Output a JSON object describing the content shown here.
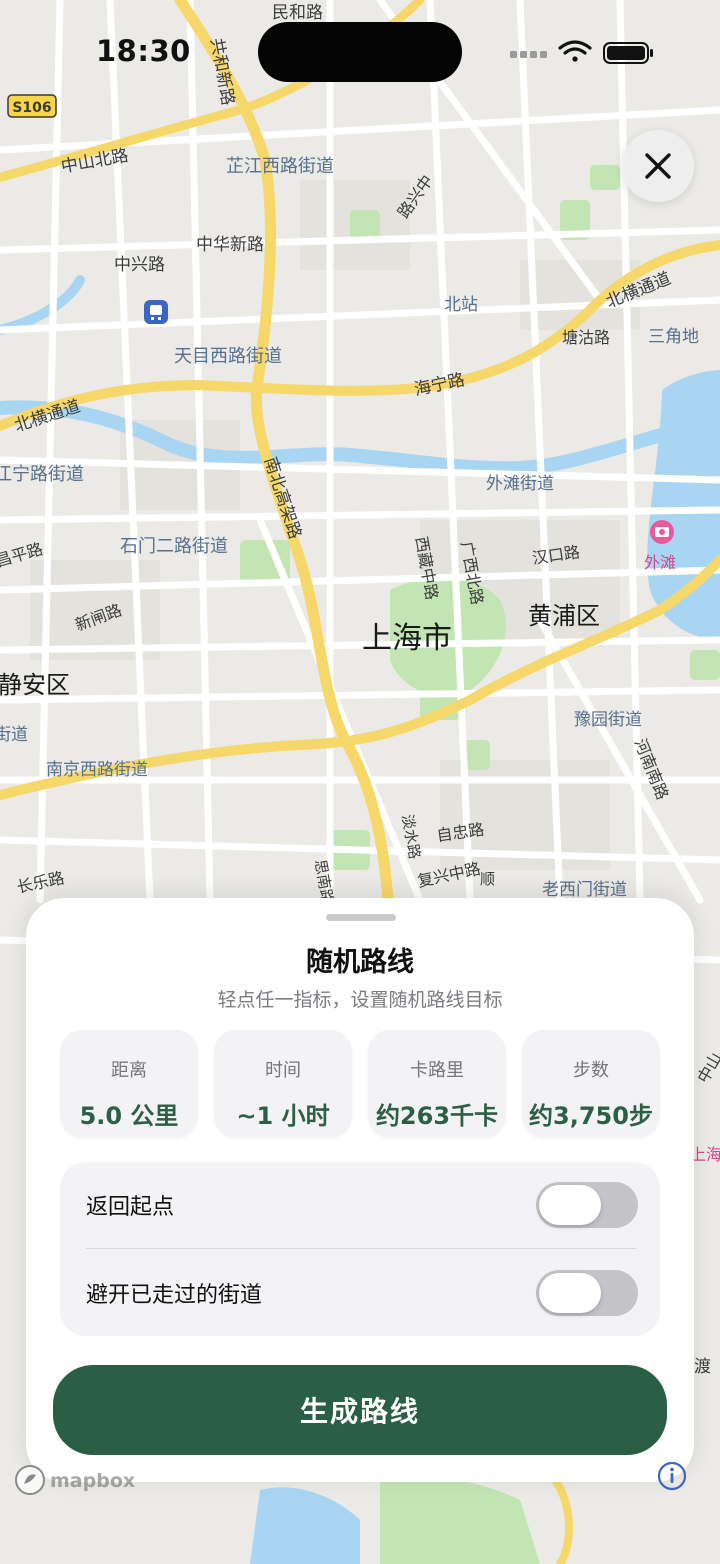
{
  "status_bar": {
    "time": "18:30"
  },
  "map": {
    "labels": {
      "s106": "S106",
      "minhe": "民和路",
      "gonghexin": "共和新路",
      "zhongshanbei": "中山北路",
      "zhijiangxi": "芷江西路街道",
      "luxiang": "路兴中",
      "zhonghuaxin": "中华新路",
      "zhongxing": "中兴路",
      "beizhan": "北站",
      "tianmuxi": "天目西路街道",
      "haining": "海宁路",
      "tangu": "塘沽路",
      "sanjiao": "三角地",
      "beiheng_left": "北横通道",
      "beiheng_right": "北横通道",
      "jiangning": "江宁路街道",
      "nanbei": "南北高架路",
      "waitan_st": "外滩街道",
      "shimen": "石门二路街道",
      "xizangzhong": "西藏中路",
      "guangxibei": "广西北路",
      "hankou": "汉口路",
      "waitan": "外滩",
      "changping": "昌平路",
      "xinzha": "新闸路",
      "shanghai": "上海市",
      "huangpu": "黄浦区",
      "jingan": "静安区",
      "jingan_st": "街道",
      "yuyuan": "豫园街道",
      "nanjingxi": "南京西路街道",
      "henannan": "河南南路",
      "dancheng": "淡水路",
      "zizhong": "自忠路",
      "fuxingzhong": "复兴中路",
      "changle": "长乐路",
      "laoximen": "老西门街道",
      "simen": "思南路",
      "shun": "顺",
      "zhongshan_r": "中山",
      "shanghai_r": "上海",
      "dudu": "渡",
      "mapbox": "mapbox"
    }
  },
  "sheet": {
    "title": "随机路线",
    "subtitle": "轻点任一指标，设置随机路线目标",
    "metrics": [
      {
        "label": "距离",
        "value": "5.0 公里"
      },
      {
        "label": "时间",
        "value": "~1 小时"
      },
      {
        "label": "卡路里",
        "value": "约263千卡"
      },
      {
        "label": "步数",
        "value": "约3,750步"
      }
    ],
    "options": [
      {
        "label": "返回起点",
        "on": false
      },
      {
        "label": "避开已走过的街道",
        "on": false
      }
    ],
    "generate_label": "生成路线"
  },
  "colors": {
    "accent": "#2b5f45",
    "metric_value": "#2c5f45",
    "map_background": "#efefec",
    "road_major": "#f6d76a",
    "water": "#a6d5f3",
    "park": "#bfe3ad"
  },
  "icons": {
    "close": "close-icon",
    "wifi": "wifi-icon",
    "battery": "battery-icon",
    "metro": "metro-icon",
    "poi": "camera-poi-icon",
    "info": "info-icon"
  }
}
